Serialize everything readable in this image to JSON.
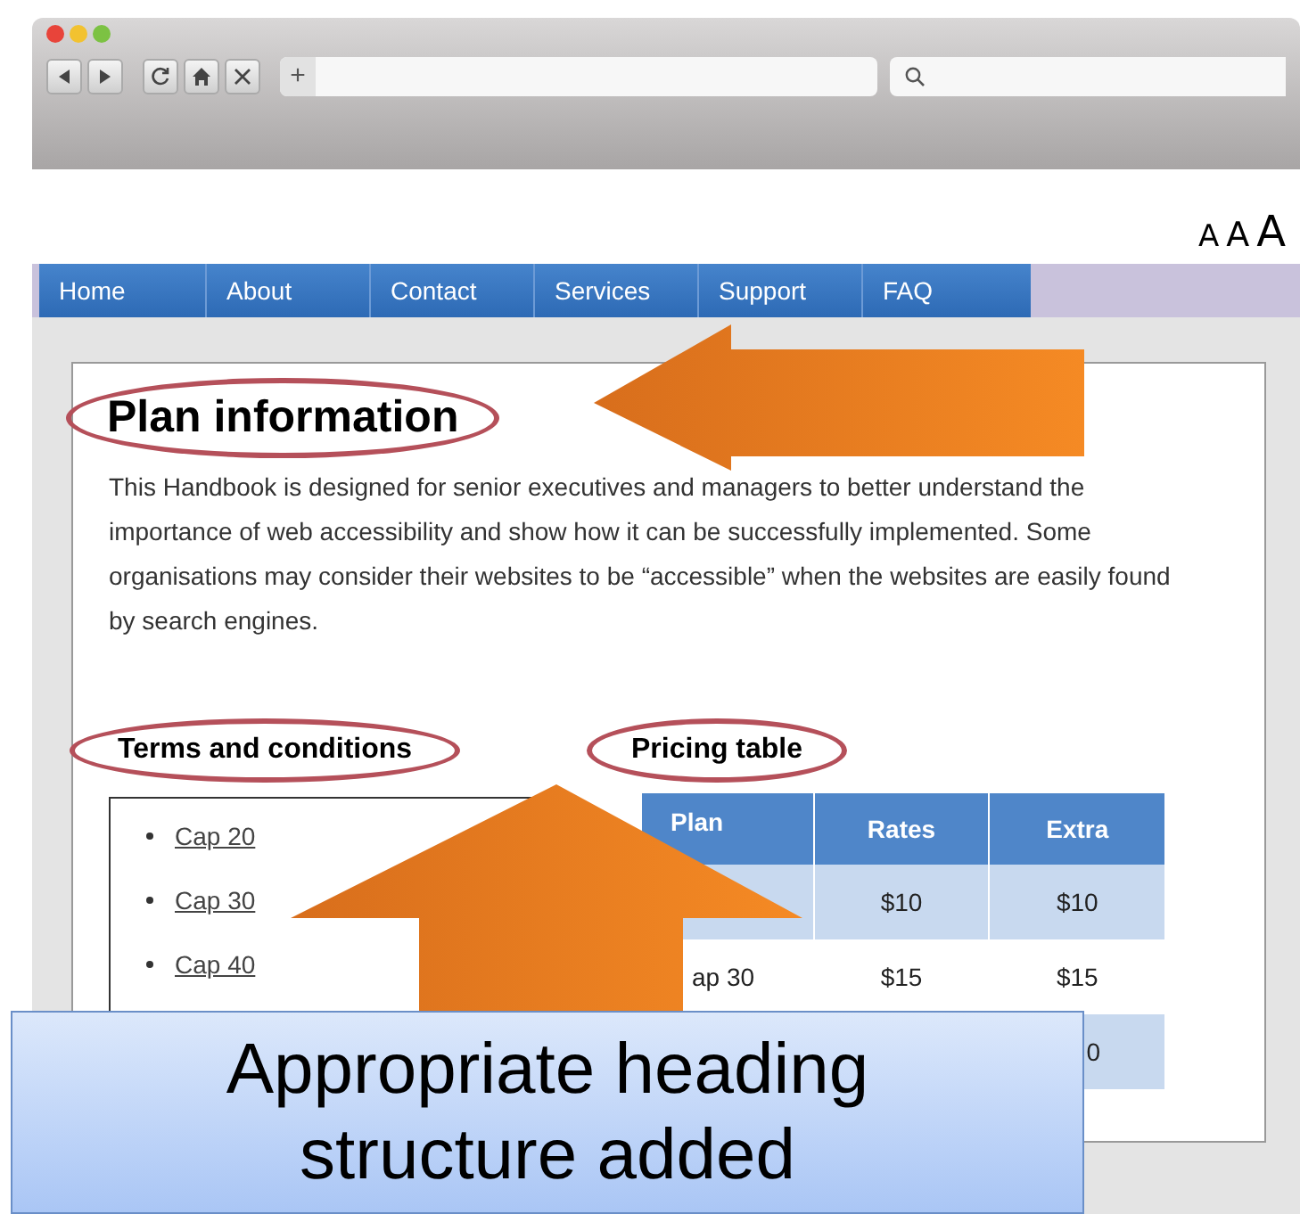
{
  "browser": {
    "new_tab_label": "+"
  },
  "text_size_options": [
    "A",
    "A",
    "A"
  ],
  "nav": [
    "Home",
    "About",
    "Contact",
    "Services",
    "Support",
    "FAQ"
  ],
  "page": {
    "title": "Plan information",
    "intro": "This Handbook is designed for senior executives and managers to better understand the importance of web accessibility and show how it can be successfully implemented. Some organisations may consider their websites to be “accessible” when the websites are easily found by search engines.",
    "terms": {
      "heading": "Terms and conditions",
      "links": [
        "Cap 20",
        "Cap 30",
        "Cap 40"
      ]
    },
    "pricing": {
      "heading": "Pricing table",
      "columns": [
        "Plan",
        "Rates",
        "Extra"
      ],
      "rows": [
        {
          "rates": "$10",
          "extra": "$10"
        },
        {
          "plan": "ap 30",
          "rates": "$15",
          "extra": "$15"
        },
        {
          "extra": "0"
        }
      ]
    }
  },
  "callout": {
    "lines": [
      "Appropriate heading",
      "structure added"
    ]
  }
}
